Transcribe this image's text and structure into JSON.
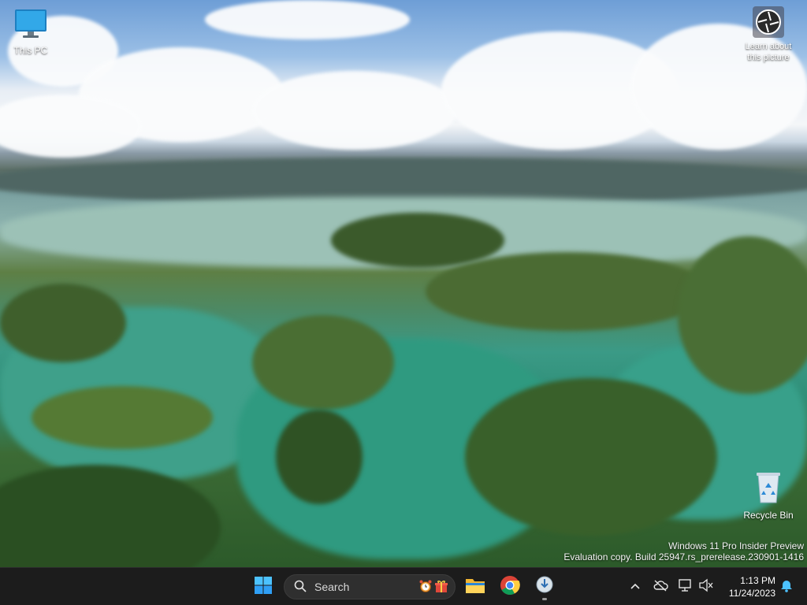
{
  "desktop": {
    "icons": [
      {
        "label": "This PC",
        "icon": "monitor-icon"
      },
      {
        "label": "Recycle Bin",
        "icon": "recycle-bin-icon"
      }
    ],
    "spotlight": {
      "line1": "Learn about",
      "line2": "this picture",
      "icon": "camera-shutter-icon"
    },
    "watermark": {
      "line1": "Windows 11 Pro Insider Preview",
      "line2": "Evaluation copy. Build 25947.rs_prerelease.230901-1416"
    }
  },
  "taskbar": {
    "start_icon": "windows-logo-icon",
    "search": {
      "placeholder": "Search",
      "icon": "search-icon",
      "promo_icons": [
        "alarm-clock-icon",
        "gift-icon"
      ]
    },
    "pinned": [
      {
        "name": "File Explorer",
        "icon": "folder-icon"
      },
      {
        "name": "Google Chrome",
        "icon": "chrome-icon"
      },
      {
        "name": "Installer",
        "icon": "download-icon"
      }
    ],
    "tray": {
      "icons": [
        "chevron-up-icon",
        "cloud-offline-icon",
        "network-icon",
        "volume-muted-icon",
        "notification-bell-icon"
      ],
      "time": "1:13 PM",
      "date": "11/24/2023"
    }
  },
  "colors": {
    "taskbar_bg": "#1c1c1c",
    "accent": "#0078d4",
    "search_bg": "#2f2f2f"
  }
}
